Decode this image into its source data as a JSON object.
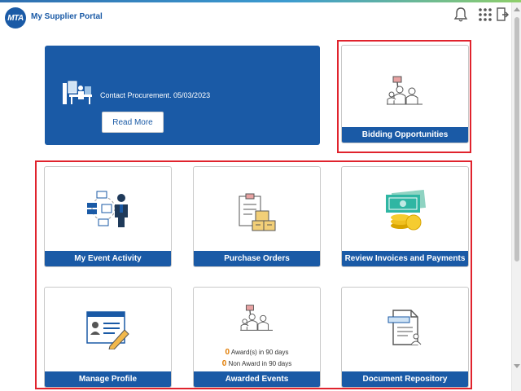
{
  "header": {
    "logo_text": "MTA",
    "portal_title": "My Supplier Portal",
    "icons": [
      "bell-icon",
      "grid-icon",
      "exit-icon"
    ]
  },
  "banner": {
    "message": "Contact Procurement. 05/03/2023",
    "button_label": "Read More"
  },
  "tiles": {
    "bidding": {
      "label": "Bidding Opportunities"
    },
    "event_activity": {
      "label": "My Event Activity"
    },
    "purchase_orders": {
      "label": "Purchase Orders"
    },
    "invoices": {
      "label": "Review Invoices and Payments"
    },
    "profile": {
      "label": "Manage Profile"
    },
    "awarded": {
      "label": "Awarded Events",
      "awards_count": "0",
      "awards_text": "Award(s) in 90 days",
      "non_award_count": "0",
      "non_award_text": "Non Award in 90 days"
    },
    "documents": {
      "label": "Document Repository"
    }
  },
  "colors": {
    "brand": "#1a5aa6",
    "highlight": "#e0232d",
    "count": "#e07b00"
  }
}
